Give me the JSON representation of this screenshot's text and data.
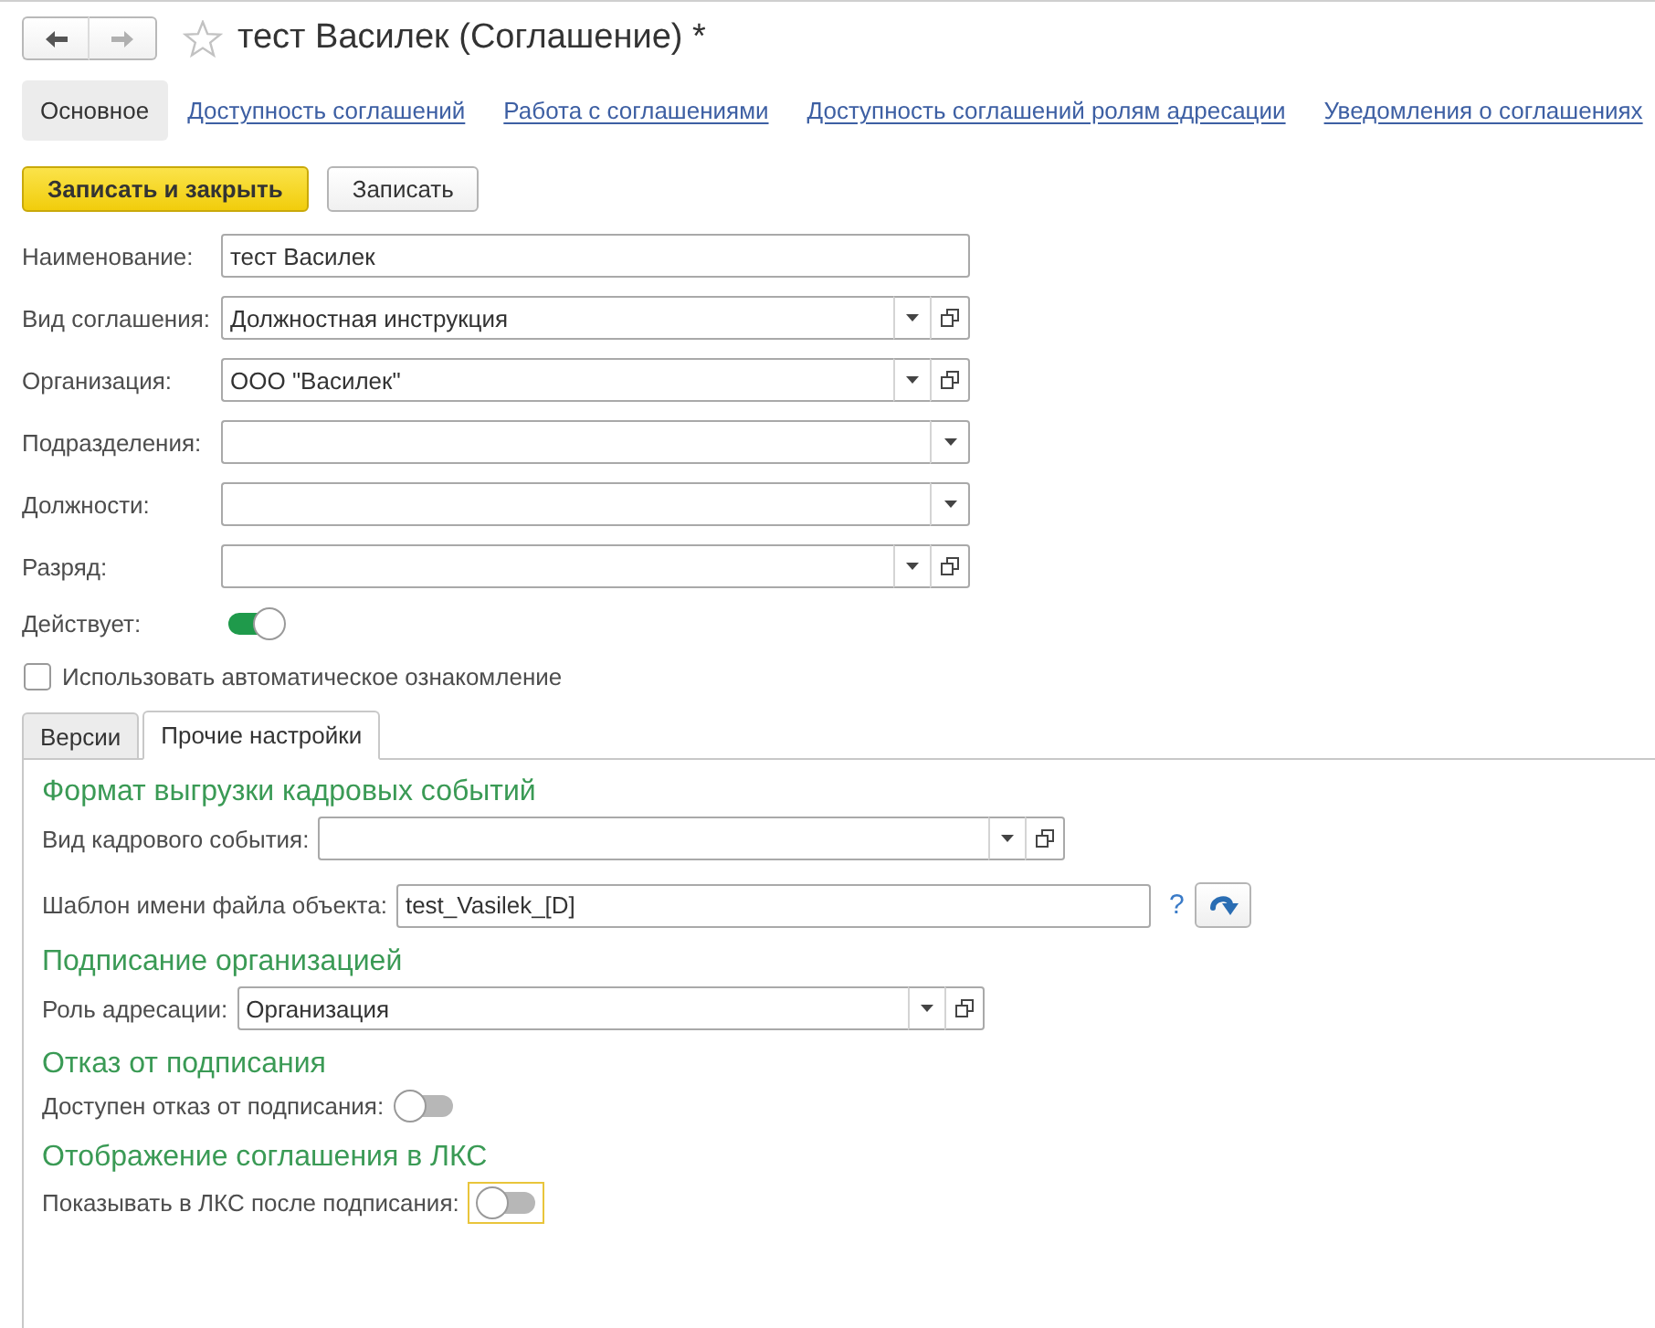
{
  "window": {
    "title": "тест Василек (Соглашение) *",
    "favorite": false
  },
  "nav": {
    "back": {
      "disabled": false
    },
    "forward": {
      "disabled": true
    }
  },
  "tabs": [
    {
      "label": "Основное",
      "selected": true
    },
    {
      "label": "Доступность соглашений",
      "selected": false
    },
    {
      "label": "Работа с соглашениями",
      "selected": false
    },
    {
      "label": "Доступность соглашений ролям адресации",
      "selected": false
    },
    {
      "label": "Уведомления о соглашениях",
      "selected": false
    }
  ],
  "buttons": [
    {
      "label": "Записать и закрыть",
      "kind": "primary"
    },
    {
      "label": "Записать",
      "kind": "default"
    }
  ],
  "fields": [
    {
      "label": "Наименование:",
      "value": "тест Василек",
      "kind": "text"
    },
    {
      "label": "Вид соглашения:",
      "value": "Должностная инструкция",
      "kind": "select_open"
    },
    {
      "label": "Организация:",
      "value": "ООО \"Василек\"",
      "kind": "select_open"
    },
    {
      "label": "Подразделения:",
      "kind": "select"
    },
    {
      "label": "Должности:",
      "kind": "select"
    },
    {
      "label": "Разряд:",
      "kind": "select_open"
    }
  ],
  "active": {
    "label": "Действует:",
    "on": true
  },
  "auto_checkbox": {
    "label": "Использовать автоматическое ознакомление",
    "checked": false
  },
  "inner_tabs": [
    {
      "label": "Версии",
      "selected": false
    },
    {
      "label": "Прочие настройки",
      "selected": true
    }
  ],
  "sections": [
    {
      "heading": "Формат выгрузки кадровых событий",
      "fields": [
        {
          "label": "Вид кадрового события:",
          "kind": "select_open"
        },
        {
          "label": "Шаблон имени файла объекта:",
          "value": "test_Vasilek_[D]",
          "kind": "text_help",
          "help": "?"
        }
      ]
    },
    {
      "heading": "Подписание организацией",
      "fields": [
        {
          "label": "Роль адресации:",
          "value": "Организация",
          "kind": "select_open"
        }
      ]
    },
    {
      "heading": "Отказ от подписания",
      "fields": [
        {
          "label": "Доступен отказ от подписания:",
          "kind": "toggle",
          "on": false,
          "focused": false
        }
      ]
    },
    {
      "heading": "Отображение соглашения в ЛКС",
      "fields": [
        {
          "label": "Показывать в ЛКС после подписания:",
          "kind": "toggle",
          "on": false,
          "focused": true
        }
      ]
    }
  ]
}
